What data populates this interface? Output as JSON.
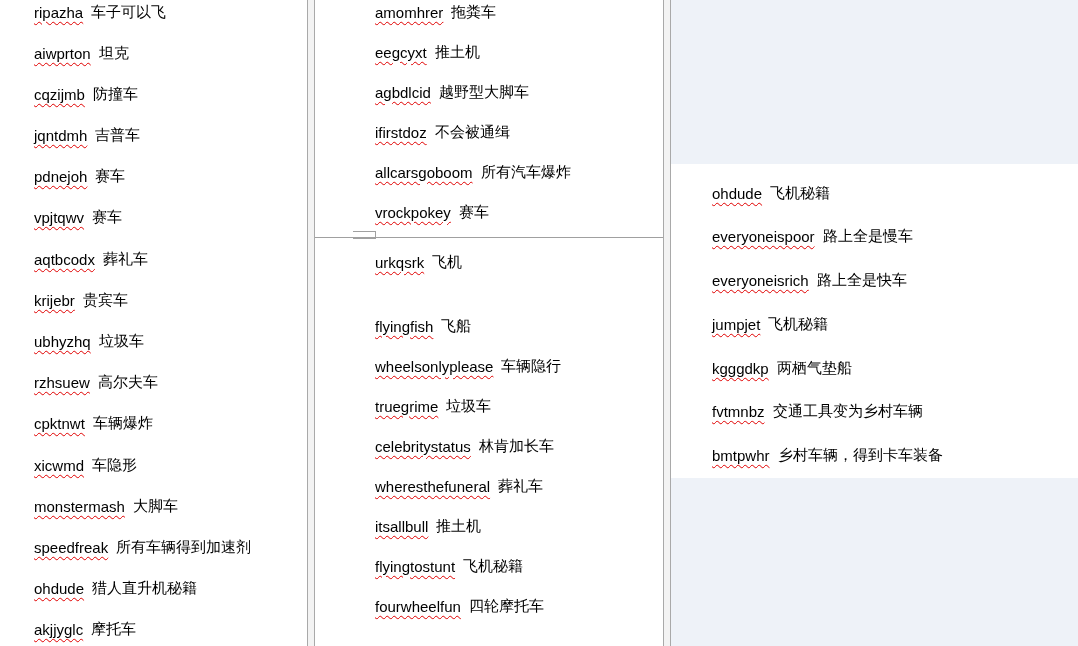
{
  "columns": [
    {
      "kind": "plain",
      "pages": [
        {
          "groups": [
            [
              {
                "code": "ripazha",
                "meaning": "车子可以飞"
              },
              {
                "code": "aiwprton",
                "meaning": "坦克"
              },
              {
                "code": "cqzijmb",
                "meaning": "防撞车"
              },
              {
                "code": "jqntdmh",
                "meaning": "吉普车"
              },
              {
                "code": "pdnejoh",
                "meaning": "赛车"
              },
              {
                "code": "vpjtqwv",
                "meaning": "赛车"
              },
              {
                "code": "aqtbcodx",
                "meaning": "葬礼车"
              },
              {
                "code": "krijebr",
                "meaning": "贵宾车"
              },
              {
                "code": "ubhyzhq",
                "meaning": "垃圾车"
              },
              {
                "code": "rzhsuew",
                "meaning": "高尔夫车"
              },
              {
                "code": "cpktnwt",
                "meaning": "车辆爆炸"
              },
              {
                "code": "xicwmd",
                "meaning": "车隐形"
              },
              {
                "code": "monstermash",
                "meaning": "大脚车"
              },
              {
                "code": "speedfreak",
                "meaning": "所有车辆得到加速剂"
              },
              {
                "code": "ohdude",
                "meaning": "猎人直升机秘籍"
              },
              {
                "code": "akjjyglc",
                "meaning": "摩托车"
              }
            ]
          ]
        }
      ]
    },
    {
      "kind": "plain",
      "pages": [
        {
          "groups": [
            [
              {
                "code": "amomhrer",
                "meaning": "拖粪车"
              },
              {
                "code": "eegcyxt",
                "meaning": "推土机"
              },
              {
                "code": "agbdlcid",
                "meaning": "越野型大脚车"
              },
              {
                "code": "ifirstdoz",
                "meaning": "不会被通缉"
              },
              {
                "code": "allcarsgoboom",
                "meaning": "所有汽车爆炸"
              },
              {
                "code": "vrockpokey",
                "meaning": "赛车"
              }
            ]
          ]
        },
        {
          "groups": [
            [
              {
                "code": "urkqsrk",
                "meaning": "飞机"
              }
            ],
            [
              {
                "code": "flyingfish",
                "meaning": "飞船"
              },
              {
                "code": "wheelsonlyplease",
                "meaning": "车辆隐行"
              },
              {
                "code": "truegrime",
                "meaning": "垃圾车"
              },
              {
                "code": "celebritystatus",
                "meaning": "林肯加长车"
              },
              {
                "code": "wheresthefuneral",
                "meaning": "葬礼车"
              },
              {
                "code": "itsallbull",
                "meaning": "推土机"
              },
              {
                "code": "flyingtostunt",
                "meaning": "飞机秘籍"
              },
              {
                "code": "fourwheelfun",
                "meaning": "四轮摩托车"
              }
            ]
          ]
        }
      ]
    },
    {
      "kind": "floating",
      "pages": [
        {
          "groups": [
            [
              {
                "code": "ohdude",
                "meaning": "飞机秘籍"
              },
              {
                "code": "everyoneispoor",
                "meaning": "路上全是慢车"
              },
              {
                "code": "everyoneisrich",
                "meaning": "路上全是快车"
              },
              {
                "code": "jumpjet",
                "meaning": "飞机秘籍"
              },
              {
                "code": "kgggdkp",
                "meaning": "两栖气垫船"
              },
              {
                "code": "fvtmnbz",
                "meaning": "交通工具变为乡村车辆"
              },
              {
                "code": "bmtpwhr",
                "meaning": "乡村车辆，得到卡车装备"
              }
            ]
          ]
        }
      ]
    }
  ]
}
